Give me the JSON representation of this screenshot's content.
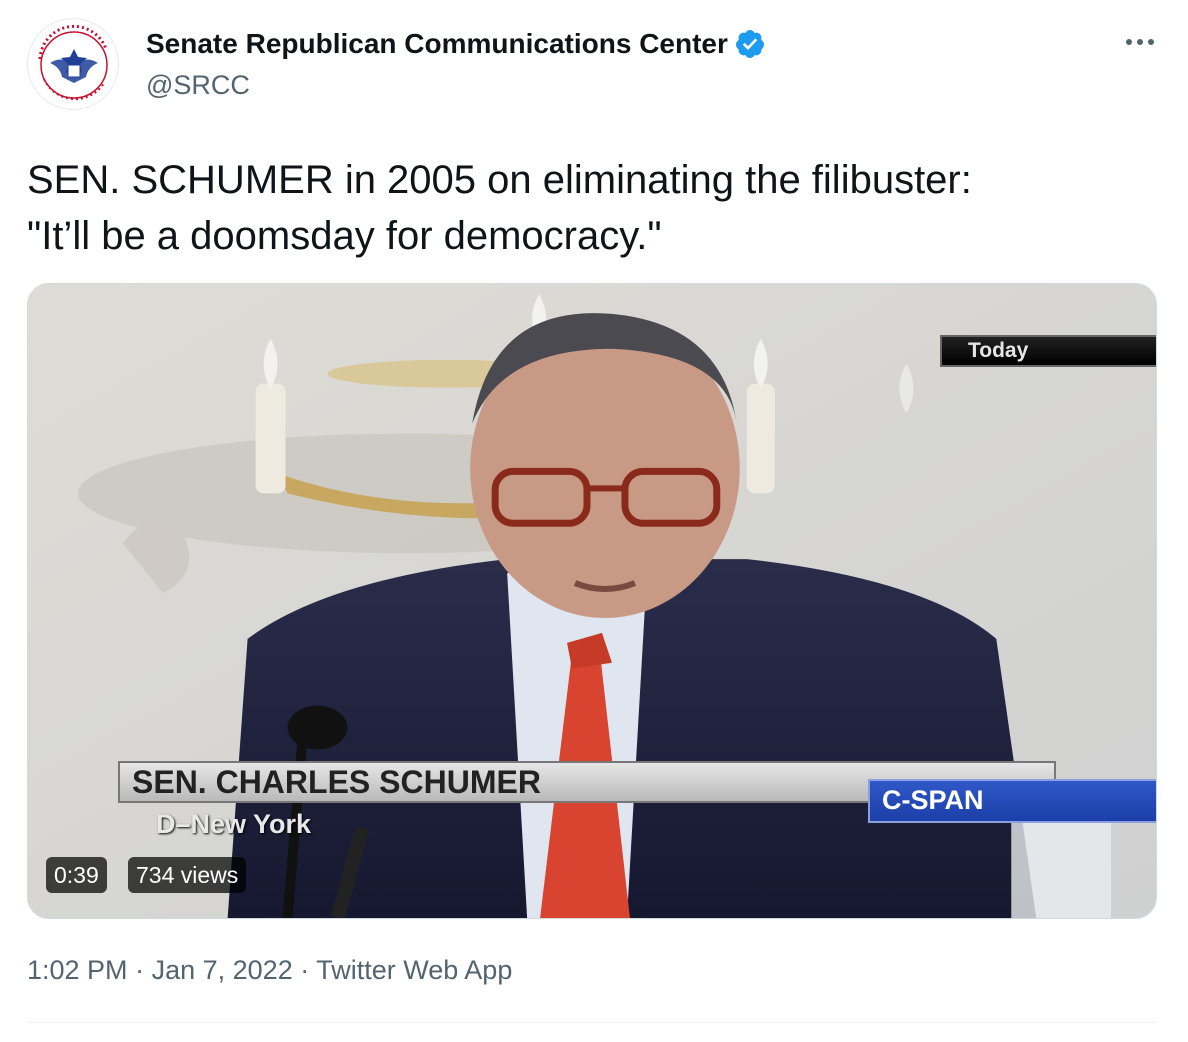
{
  "author": {
    "display_name": "Senate Republican Communications Center",
    "handle": "@SRCC",
    "avatar_ring_text": "SENATE REPUBLICAN COMMUNICATIONS CENTER",
    "avatar_icon": "eagle-seal",
    "verified_icon": "verified-badge-icon",
    "verified_color": "#1d9bf0"
  },
  "tweet": {
    "text_lines": [
      "SEN. SCHUMER in 2005 on eliminating the filibuster:",
      "\"It’ll be a doomsday for democracy.\""
    ]
  },
  "video": {
    "overlay_today": "Today",
    "chyron_name": "SEN. CHARLES SCHUMER",
    "chyron_sub": "D–New York",
    "network": "C-SPAN",
    "duration": "0:39",
    "views": "734 views"
  },
  "meta": {
    "time": "1:02 PM",
    "separator": "·",
    "date": "Jan 7, 2022",
    "source": "Twitter Web App"
  },
  "colors": {
    "text_primary": "#0f1419",
    "text_secondary": "#536471",
    "brand_red": "#c8102e",
    "brand_blue": "#1f3e95",
    "cspan_blue": "#1c3ea8"
  }
}
